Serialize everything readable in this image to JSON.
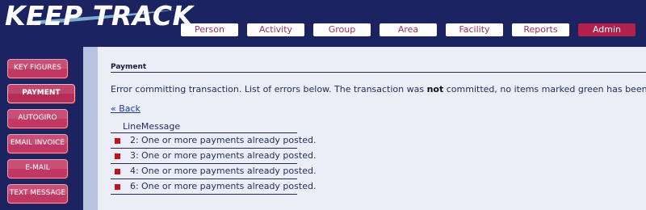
{
  "header": {
    "logo_text": "KEEP TRACK",
    "nav": [
      {
        "label": "Person"
      },
      {
        "label": "Activity"
      },
      {
        "label": "Group"
      },
      {
        "label": "Area"
      },
      {
        "label": "Facility"
      },
      {
        "label": "Reports"
      },
      {
        "label": "Admin",
        "active": true
      }
    ]
  },
  "sidebar": {
    "items": [
      {
        "label": "KEY FIGURES"
      },
      {
        "label": "PAYMENT",
        "active": true
      },
      {
        "label": "AUTOGIRO"
      },
      {
        "label": "EMAIL INVOICE"
      },
      {
        "label": "E-MAIL"
      },
      {
        "label": "TEXT MESSAGE"
      }
    ]
  },
  "main": {
    "section_title": "Payment",
    "message_before": "Error committing transaction. List of errors below. The transaction was ",
    "message_bold": "not",
    "message_after": " committed, no items marked green has been processed. Plea",
    "back_link": "« Back",
    "table": {
      "header": "LineMessage",
      "rows": [
        {
          "line": "2:",
          "message": "One or more payments already posted."
        },
        {
          "line": "3:",
          "message": "One or more payments already posted."
        },
        {
          "line": "4:",
          "message": "One or more payments already posted."
        },
        {
          "line": "6:",
          "message": "One or more payments already posted."
        }
      ]
    }
  },
  "colors": {
    "navy": "#1b2460",
    "admin_tab": "#b3204c",
    "sidebar_button": "#c13863",
    "error_marker": "#c2121e",
    "content_bg": "#eceef7"
  }
}
